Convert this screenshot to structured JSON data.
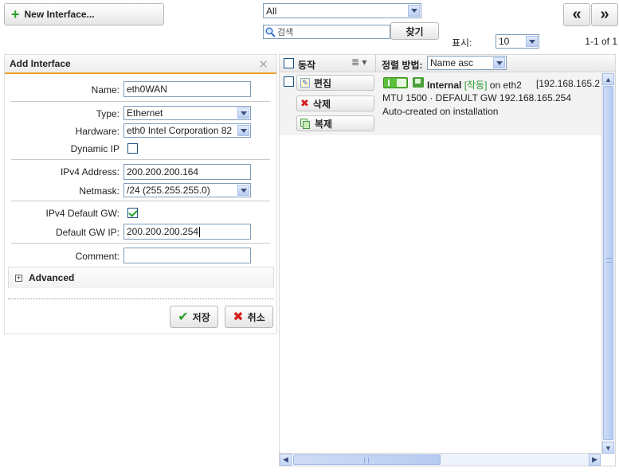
{
  "toolbar": {
    "new_interface_label": "New Interface...",
    "filter_value": "All",
    "search_placeholder": "검색",
    "search_button": "찾기",
    "show_label": "표시:",
    "page_size": "10",
    "range_text": "1-1 of 1",
    "prev_label": "«",
    "next_label": "»"
  },
  "form": {
    "title": "Add Interface",
    "name_label": "Name:",
    "name_value": "eth0WAN",
    "type_label": "Type:",
    "type_value": "Ethernet",
    "hardware_label": "Hardware:",
    "hardware_value": "eth0 Intel Corporation 82",
    "dynamic_ip_label": "Dynamic IP",
    "dynamic_ip_checked": false,
    "ipv4_address_label": "IPv4 Address:",
    "ipv4_address_value": "200.200.200.164",
    "netmask_label": "Netmask:",
    "netmask_value": "/24 (255.255.255.0)",
    "ipv4_default_gw_label": "IPv4 Default GW:",
    "ipv4_default_gw_checked": true,
    "default_gw_ip_label": "Default GW IP:",
    "default_gw_ip_value": "200.200.200.254",
    "comment_label": "Comment:",
    "comment_value": "",
    "advanced_label": "Advanced",
    "save_label": "저장",
    "cancel_label": "취소"
  },
  "list": {
    "action_header": "동작",
    "sort_label": "정렬 방법:",
    "sort_value": "Name asc",
    "row": {
      "edit_label": "편집",
      "delete_label": "삭제",
      "clone_label": "복제",
      "name": "Internal",
      "status": "[작동]",
      "on_text": "on eth2",
      "address": "[192.168.165.2",
      "details": "MTU 1500 · DEFAULT GW 192.168.165.254",
      "comment": "Auto-created on installation"
    }
  },
  "colors": {
    "accent_orange": "#f0a030",
    "status_green": "#2a9a2a",
    "add_green": "#2aa02a",
    "delete_red": "#d42020"
  }
}
